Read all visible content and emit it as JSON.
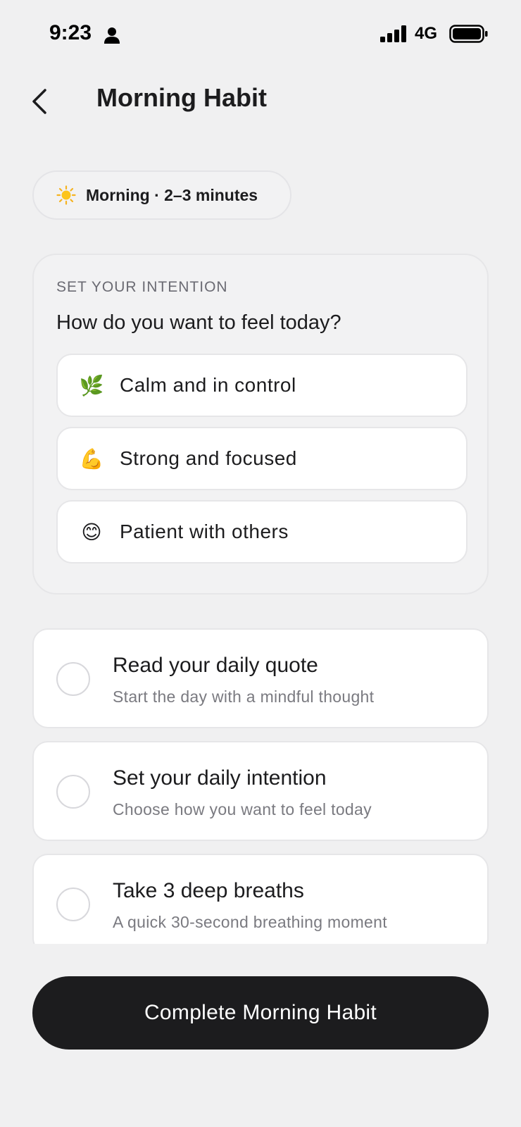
{
  "status_bar": {
    "time": "9:23",
    "network": "4G",
    "icons": [
      "person-icon",
      "signal-icon",
      "battery-icon"
    ]
  },
  "header": {
    "title": "Morning Habit",
    "back_icon": "chevron-left-icon"
  },
  "meta_pill": {
    "icon": "sun-icon",
    "text": "Morning · 2–3 minutes"
  },
  "intention": {
    "section_label": "SET YOUR INTENTION",
    "question": "How do you want to feel today?",
    "options": [
      {
        "emoji": "🌿",
        "icon": "herb-icon",
        "label": "Calm and in control"
      },
      {
        "emoji": "💪",
        "icon": "flexed-biceps-icon",
        "label": "Strong and focused"
      },
      {
        "emoji": "😊",
        "icon": "smiling-face-icon",
        "label": "Patient with others"
      }
    ]
  },
  "tasks": [
    {
      "title": "Read your daily quote",
      "subtitle": "Start the day with a mindful thought",
      "checked": false
    },
    {
      "title": "Set your daily intention",
      "subtitle": "Choose how you want to feel today",
      "checked": false
    },
    {
      "title": "Take 3 deep breaths",
      "subtitle": "A quick 30-second breathing moment",
      "checked": false
    }
  ],
  "cta": {
    "label": "Complete Morning Habit"
  },
  "colors": {
    "background": "#f0f0f1",
    "card": "#ffffff",
    "text_primary": "#1c1c1e",
    "text_secondary": "#7a7a80",
    "cta_background": "#1c1c1e",
    "cta_text": "#ffffff"
  }
}
